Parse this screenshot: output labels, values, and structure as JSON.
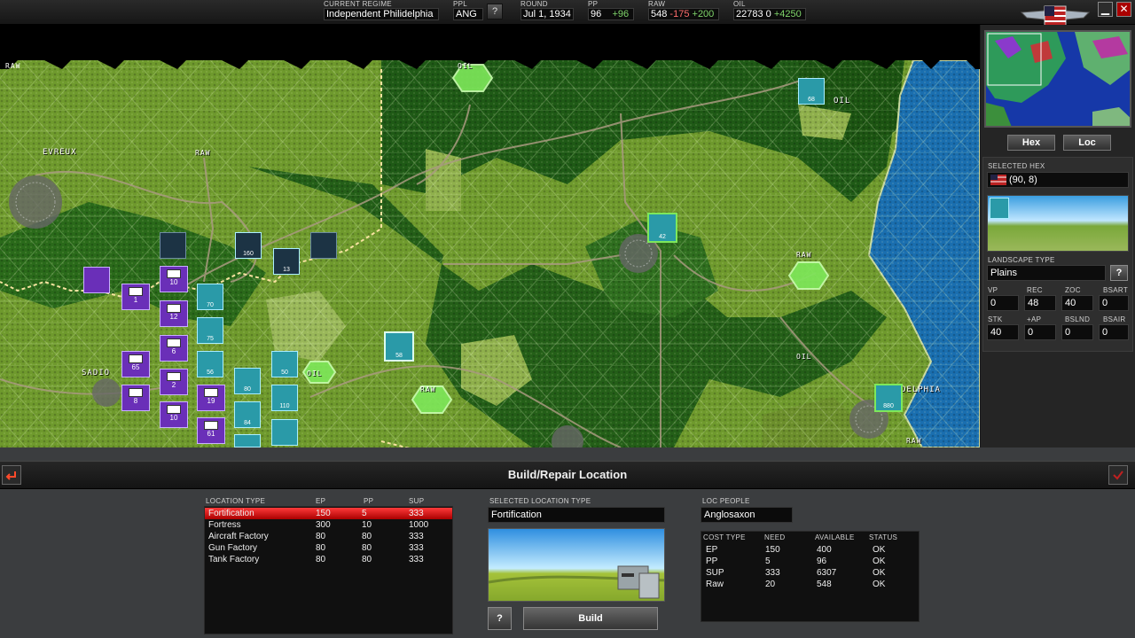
{
  "top": {
    "regime_label": "CURRENT REGIME",
    "regime": "Independent Philidelphia",
    "ppl_label": "PPL",
    "ppl": "ANG",
    "help": "?",
    "round_label": "ROUND",
    "round": "Jul 1, 1934",
    "pp_label": "PP",
    "pp_value": "96",
    "pp_delta": "+96",
    "raw_label": "RAW",
    "raw_value": "548",
    "raw_minus": "-175",
    "raw_plus": "+200",
    "oil_label": "OIL",
    "oil_value": "22783",
    "oil_zero": "0",
    "oil_plus": "+4250",
    "minimize": "▁",
    "close": "✕"
  },
  "map": {
    "labels": [
      "RAW",
      "EVREUX",
      "RAW",
      "OIL",
      "OIL",
      "RAW",
      "OIL",
      "SADIO",
      "RAW",
      "OIL",
      "DELPHIA",
      "RAW"
    ],
    "units_player": [
      {
        "n": "1"
      },
      {
        "n": "10"
      },
      {
        "n": "12"
      },
      {
        "n": "6"
      },
      {
        "n": "2"
      },
      {
        "n": "10"
      },
      {
        "n": "65"
      },
      {
        "n": "8"
      },
      {
        "n": "19"
      },
      {
        "n": "61"
      }
    ],
    "units_enemy": [
      "70",
      "75",
      "56",
      "80",
      "50",
      "84",
      "110",
      "160",
      "13",
      "42",
      "58",
      "68",
      "880"
    ]
  },
  "side": {
    "hex_btn": "Hex",
    "loc_btn": "Loc",
    "selected_hex_label": "SELECTED HEX",
    "selected_hex": "(90, 8)",
    "landscape_label": "LANDSCAPE TYPE",
    "landscape": "Plains",
    "help": "?",
    "stats": [
      {
        "label": "VP",
        "value": "0"
      },
      {
        "label": "REC",
        "value": "48"
      },
      {
        "label": "ZOC",
        "value": "40"
      },
      {
        "label": "BSART",
        "value": "0"
      },
      {
        "label": "STK",
        "value": "40"
      },
      {
        "label": "+AP",
        "value": "0"
      },
      {
        "label": "BSLND",
        "value": "0"
      },
      {
        "label": "BSAIR",
        "value": "0"
      }
    ]
  },
  "bottom": {
    "title": "Build/Repair Location",
    "location_table": {
      "headers": [
        "LOCATION TYPE",
        "EP",
        "PP",
        "SUP"
      ],
      "rows": [
        [
          "Fortification",
          "150",
          "5",
          "333"
        ],
        [
          "Fortress",
          "300",
          "10",
          "1000"
        ],
        [
          "Aircraft Factory",
          "80",
          "80",
          "333"
        ],
        [
          "Gun Factory",
          "80",
          "80",
          "333"
        ],
        [
          "Tank Factory",
          "80",
          "80",
          "333"
        ]
      ]
    },
    "selected_type_label": "SELECTED LOCATION TYPE",
    "selected_type": "Fortification",
    "help": "?",
    "build": "Build",
    "loc_people_label": "LOC PEOPLE",
    "loc_people": "Anglosaxon",
    "cost_table": {
      "headers": [
        "COST TYPE",
        "NEED",
        "AVAILABLE",
        "STATUS"
      ],
      "rows": [
        [
          "EP",
          "150",
          "400",
          "OK"
        ],
        [
          "PP",
          "5",
          "96",
          "OK"
        ],
        [
          "SUP",
          "333",
          "6307",
          "OK"
        ],
        [
          "Raw",
          "20",
          "548",
          "OK"
        ]
      ]
    }
  },
  "colors": {
    "accent_red": "#e21e1e",
    "player_purple": "#6a2fb8",
    "enemy_teal": "#2a9aa8",
    "sea": "#1a6fb0",
    "forest": "#1f5a16",
    "plains": "#6f9a2d"
  }
}
